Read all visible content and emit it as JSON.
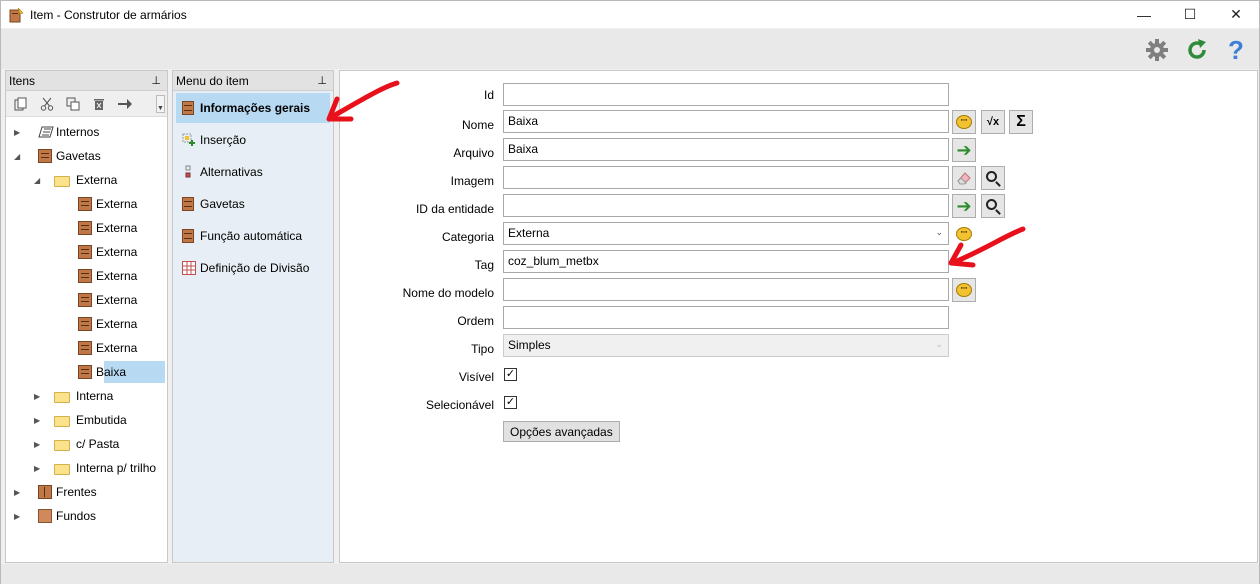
{
  "window": {
    "title": "Item - Construtor de armários",
    "controls": {
      "minimize": "—",
      "maximize": "☐",
      "close": "✕"
    }
  },
  "toolbar": {
    "icons": [
      "gear-icon",
      "refresh-icon",
      "help-icon"
    ],
    "help_glyph": "?",
    "gear_color": "#7f7f7f",
    "refresh_color": "#2e8b3a",
    "help_color": "#3d7fd8"
  },
  "items_panel": {
    "title": "Itens",
    "pin": "⊥",
    "tools": [
      "copy-icon",
      "cut-icon",
      "duplicate-icon",
      "delete-icon",
      "move-icon"
    ],
    "tree": [
      {
        "label": "Internos",
        "level": 0,
        "expander": "▶",
        "icon": "hatched-icon"
      },
      {
        "label": "Gavetas",
        "level": 0,
        "expander": "◢",
        "icon": "drawer-icon"
      },
      {
        "label": "Externa",
        "level": 1,
        "expander": "◢",
        "icon": "folder-icon"
      },
      {
        "label": "Externa",
        "level": 2,
        "expander": "",
        "icon": "drawer-icon"
      },
      {
        "label": "Externa",
        "level": 2,
        "expander": "",
        "icon": "drawer-icon"
      },
      {
        "label": "Externa",
        "level": 2,
        "expander": "",
        "icon": "drawer-icon"
      },
      {
        "label": "Externa",
        "level": 2,
        "expander": "",
        "icon": "drawer-icon"
      },
      {
        "label": "Externa",
        "level": 2,
        "expander": "",
        "icon": "drawer-icon"
      },
      {
        "label": "Externa",
        "level": 2,
        "expander": "",
        "icon": "drawer-icon"
      },
      {
        "label": "Externa",
        "level": 2,
        "expander": "",
        "icon": "drawer-icon"
      },
      {
        "label": "Baixa",
        "level": 2,
        "expander": "",
        "icon": "drawer-icon",
        "selected": true
      },
      {
        "label": "Interna",
        "level": 1,
        "expander": "▶",
        "icon": "folder-icon"
      },
      {
        "label": "Embutida",
        "level": 1,
        "expander": "▶",
        "icon": "folder-icon"
      },
      {
        "label": "c/ Pasta",
        "level": 1,
        "expander": "▶",
        "icon": "folder-icon"
      },
      {
        "label": "Interna p/ trilho",
        "level": 1,
        "expander": "▶",
        "icon": "folder-icon"
      },
      {
        "label": "Frentes",
        "level": 0,
        "expander": "▶",
        "icon": "front-icon"
      },
      {
        "label": "Fundos",
        "level": 0,
        "expander": "▶",
        "icon": "back-panel-icon"
      }
    ]
  },
  "menu_panel": {
    "title": "Menu do item",
    "pin": "⊥",
    "items": [
      {
        "label": "Informações gerais",
        "icon": "drawer-icon",
        "active": true
      },
      {
        "label": "Inserção",
        "icon": "insert-icon"
      },
      {
        "label": "Alternativas",
        "icon": "alternatives-icon"
      },
      {
        "label": "Gavetas",
        "icon": "drawer-icon"
      },
      {
        "label": "Função automática",
        "icon": "drawer-icon"
      },
      {
        "label": "Definição de Divisão",
        "icon": "grid-icon"
      }
    ]
  },
  "form": {
    "id": {
      "label": "Id",
      "value": ""
    },
    "nome": {
      "label": "Nome",
      "value": "Baixa"
    },
    "arquivo": {
      "label": "Arquivo",
      "value": "Baixa"
    },
    "imagem": {
      "label": "Imagem",
      "value": ""
    },
    "id_entidade": {
      "label": "ID da entidade",
      "value": ""
    },
    "categoria": {
      "label": "Categoria",
      "value": "Externa"
    },
    "tag": {
      "label": "Tag",
      "value": "coz_blum_metbx"
    },
    "nome_modelo": {
      "label": "Nome do modelo",
      "value": ""
    },
    "ordem": {
      "label": "Ordem",
      "value": ""
    },
    "tipo": {
      "label": "Tipo",
      "value": "Simples"
    },
    "visivel": {
      "label": "Visível",
      "checked": true,
      "mark": "✓"
    },
    "selecionavel": {
      "label": "Selecionável",
      "checked": true,
      "mark": "✓"
    },
    "advanced_button": "Opções avançadas",
    "buttons": {
      "sqrt_glyph": "√x",
      "sigma_glyph": "Σ",
      "arrow_glyph": "➔",
      "translate_glyph": "\"\""
    }
  },
  "annotations": {
    "arrow_color": "#e8101a"
  }
}
